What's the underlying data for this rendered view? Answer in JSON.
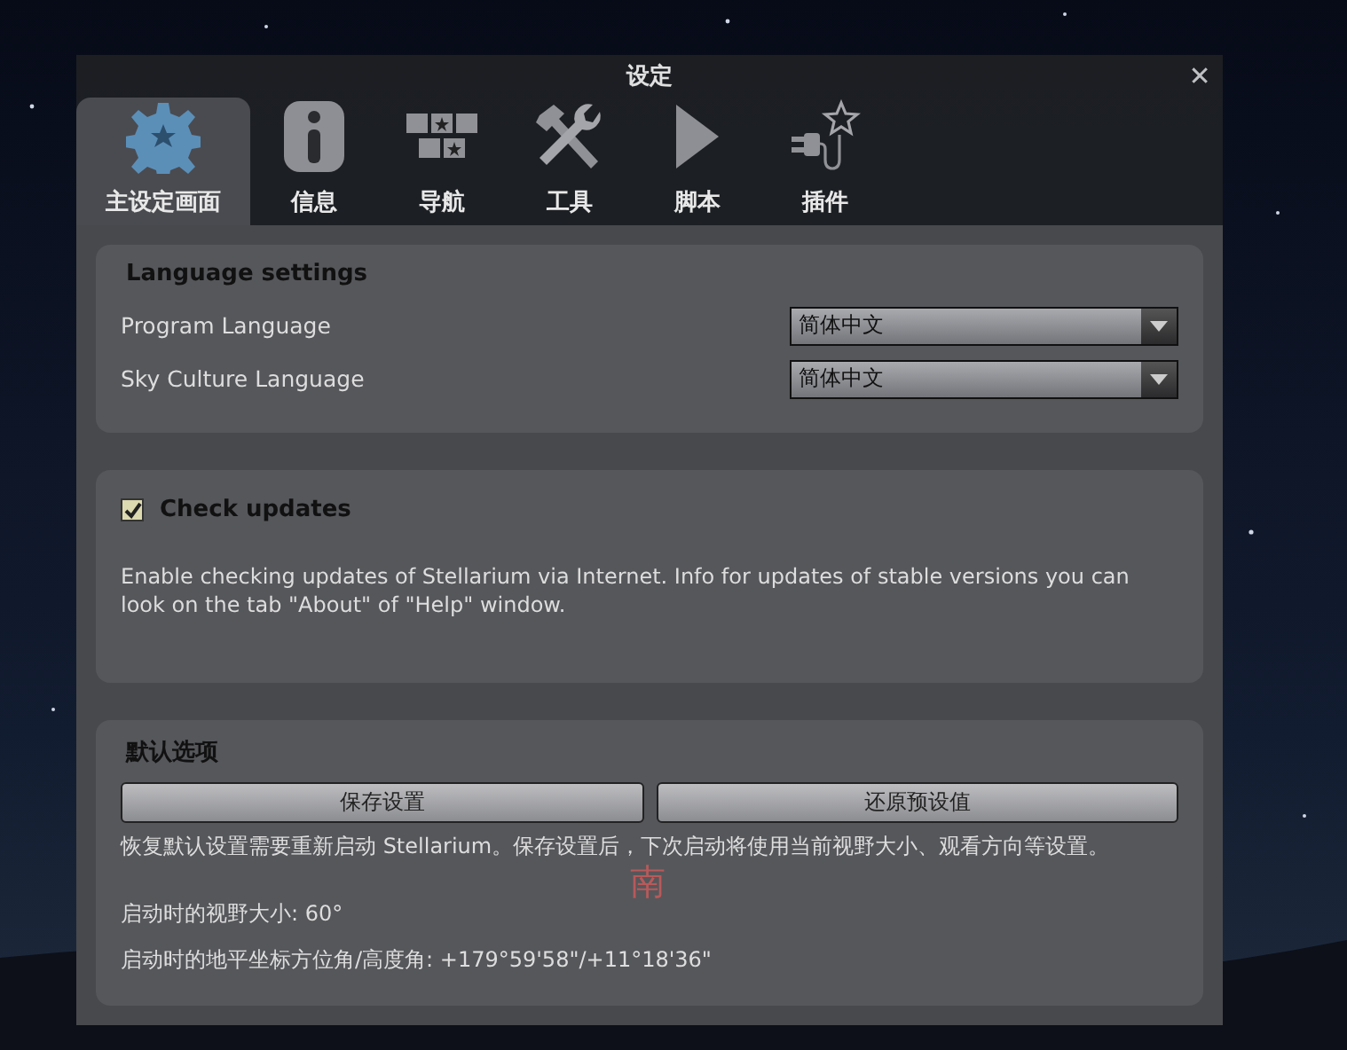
{
  "window": {
    "title": "设定",
    "close": "✕"
  },
  "tabs": [
    {
      "label": "主设定画面",
      "kind": "gear",
      "selected": true
    },
    {
      "label": "信息",
      "kind": "info",
      "selected": false
    },
    {
      "label": "导航",
      "kind": "blocks",
      "selected": false
    },
    {
      "label": "工具",
      "kind": "tools",
      "selected": false
    },
    {
      "label": "脚本",
      "kind": "play",
      "selected": false
    },
    {
      "label": "插件",
      "kind": "plugin",
      "selected": false
    }
  ],
  "language_settings": {
    "title": "Language settings",
    "rows": [
      {
        "label": "Program Language",
        "value": "简体中文"
      },
      {
        "label": "Sky Culture Language",
        "value": "简体中文"
      }
    ]
  },
  "check_updates": {
    "label": "Check updates",
    "checked": true,
    "description": "Enable checking updates of Stellarium via Internet. Info for updates of stable versions you can look on the tab \"About\" of \"Help\" window."
  },
  "defaults": {
    "title": "默认选项",
    "buttons": [
      "保存设置",
      "还原预设值"
    ],
    "note": "恢复默认设置需要重新启动 Stellarium。保存设置后，下次启动将使用当前视野大小、观看方向等设置。",
    "fov": "启动时的视野大小: 60°",
    "direction": "启动时的地平坐标方位角/高度角: +179°59'58\"/+11°18'36\""
  },
  "sky_label": "南"
}
